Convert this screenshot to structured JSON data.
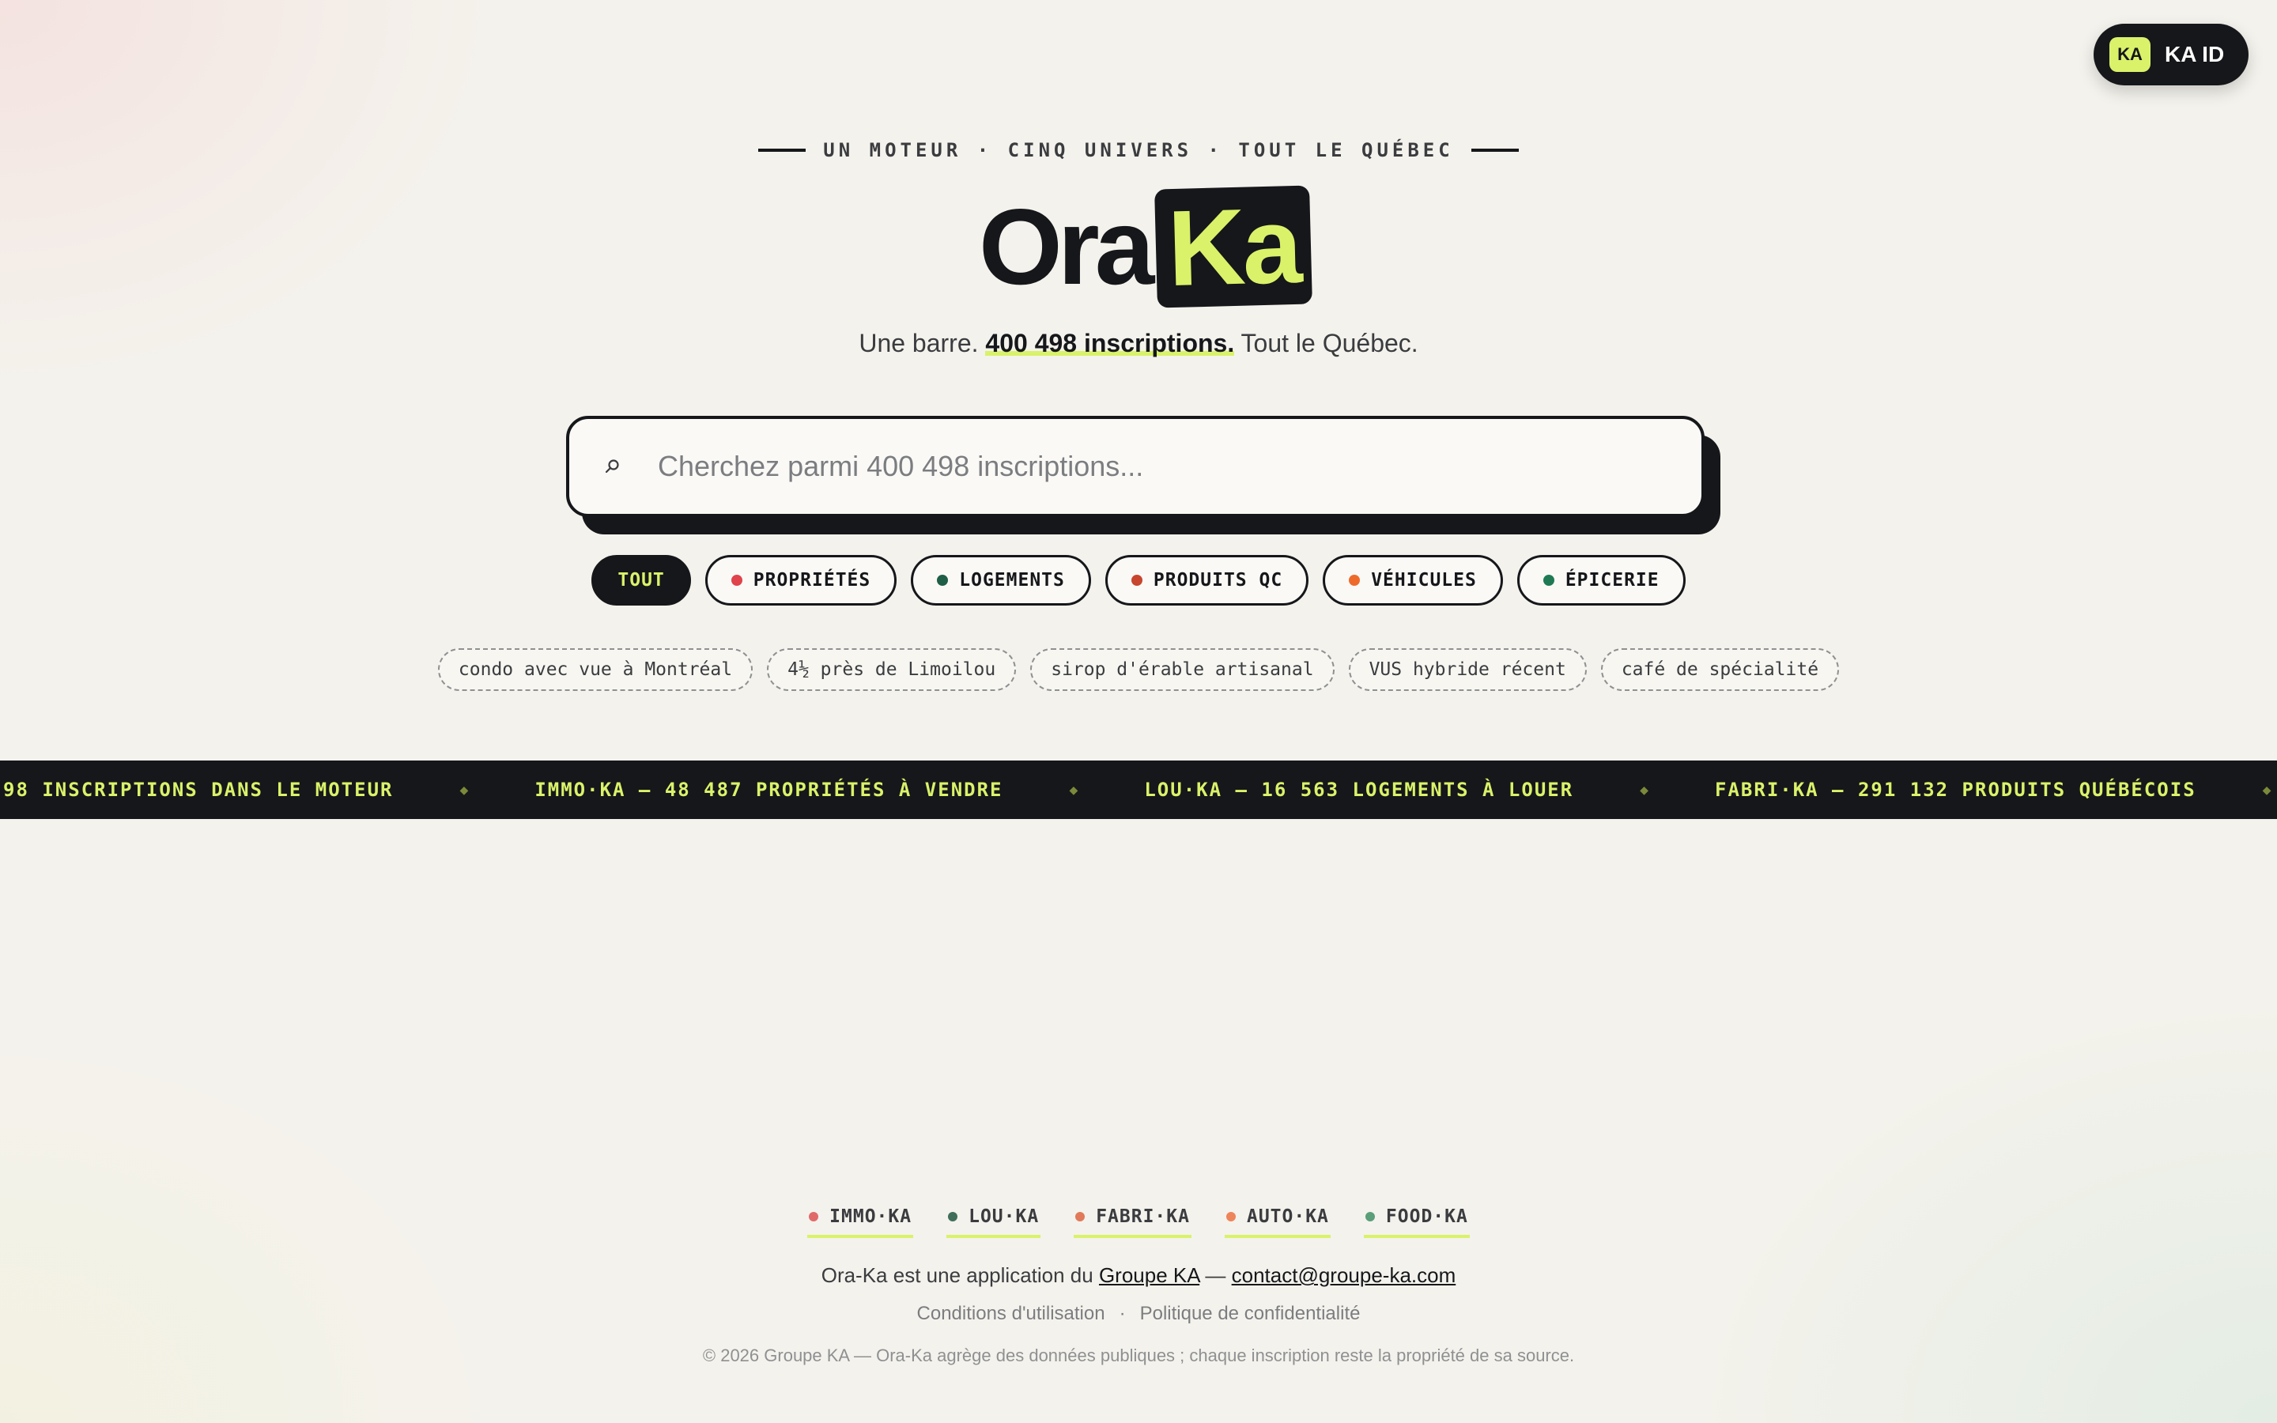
{
  "account": {
    "badge": "KA",
    "label": "KA ID"
  },
  "hero": {
    "eyebrow": "UN MOTEUR · CINQ UNIVERS · TOUT LE QUÉBEC",
    "logo_part1": "Ora",
    "logo_part2": "Ka",
    "tagline_before": "Une barre.",
    "tagline_highlight": "400 498 inscriptions.",
    "tagline_after": "Tout le Québec."
  },
  "search": {
    "icon": "search-icon",
    "placeholder": "Cherchez parmi 400 498 inscriptions..."
  },
  "filters": [
    {
      "label": "TOUT",
      "active": true,
      "color": ""
    },
    {
      "label": "PROPRIÉTÉS",
      "active": false,
      "color": "#e0434b"
    },
    {
      "label": "LOGEMENTS",
      "active": false,
      "color": "#1f5e47"
    },
    {
      "label": "PRODUITS QC",
      "active": false,
      "color": "#c8452e"
    },
    {
      "label": "VÉHICULES",
      "active": false,
      "color": "#ee6a2b"
    },
    {
      "label": "ÉPICERIE",
      "active": false,
      "color": "#1f7a54"
    }
  ],
  "suggestions": [
    "condo avec vue à Montréal",
    "4½ près de Limoilou",
    "sirop d'érable artisanal",
    "VUS hybride récent",
    "café de spécialité"
  ],
  "ticker": [
    "98 INSCRIPTIONS DANS LE MOTEUR",
    "IMMO·KA — 48 487 PROPRIÉTÉS À VENDRE",
    "LOU·KA — 16 563 LOGEMENTS À LOUER",
    "FABRI·KA — 291 132 PRODUITS QUÉBÉCOIS"
  ],
  "ticker_separator": "◆",
  "footer": {
    "brands": [
      {
        "label": "IMMO·KA",
        "color": "#e06a6a"
      },
      {
        "label": "LOU·KA",
        "color": "#3f6e5a"
      },
      {
        "label": "FABRI·KA",
        "color": "#e07a5a"
      },
      {
        "label": "AUTO·KA",
        "color": "#ee845a"
      },
      {
        "label": "FOOD·KA",
        "color": "#5a9e7a"
      }
    ],
    "credit_prefix": "Ora-Ka est une application du",
    "credit_company": "Groupe KA",
    "credit_dash": "—",
    "credit_email": "contact@groupe-ka.com",
    "terms": "Conditions d'utilisation",
    "separator": "·",
    "privacy": "Politique de confidentialité",
    "copyright": "© 2026 Groupe KA — Ora-Ka agrège des données publiques ; chaque inscription reste la propriété de sa source."
  }
}
